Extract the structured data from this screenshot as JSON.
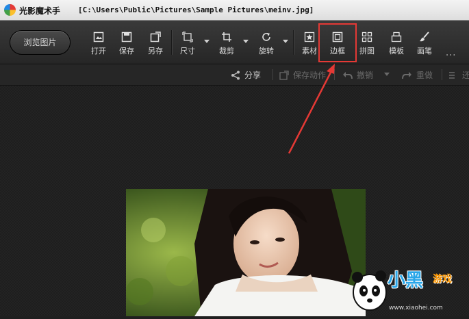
{
  "titlebar": {
    "app_name": "光影魔术手",
    "file_path": "[C:\\Users\\Public\\Pictures\\Sample Pictures\\meinv.jpg]"
  },
  "toolbar": {
    "browse_label": "浏览图片",
    "tools": [
      {
        "id": "open",
        "label": "打开",
        "icon": "open-icon"
      },
      {
        "id": "save",
        "label": "保存",
        "icon": "save-icon"
      },
      {
        "id": "save-as",
        "label": "另存",
        "icon": "save-as-icon"
      },
      {
        "id": "size",
        "label": "尺寸",
        "icon": "resize-icon"
      },
      {
        "id": "crop",
        "label": "裁剪",
        "icon": "crop-icon"
      },
      {
        "id": "rotate",
        "label": "旋转",
        "icon": "rotate-icon"
      },
      {
        "id": "material",
        "label": "素材",
        "icon": "star-icon"
      },
      {
        "id": "border",
        "label": "边框",
        "icon": "border-icon"
      },
      {
        "id": "collage",
        "label": "拼图",
        "icon": "grid-icon"
      },
      {
        "id": "template",
        "label": "模板",
        "icon": "template-icon"
      },
      {
        "id": "brush",
        "label": "画笔",
        "icon": "brush-icon"
      }
    ],
    "more": "···"
  },
  "actions": {
    "share": "分享",
    "save_action": "保存动作",
    "undo": "撤销",
    "redo": "重做",
    "extra": "还"
  },
  "watermark": {
    "text": "小黑",
    "sub": "游戏",
    "url": "www.xiaohei.com"
  },
  "colors": {
    "highlight": "#e53935",
    "watermark_blue": "#2aa6e8"
  }
}
